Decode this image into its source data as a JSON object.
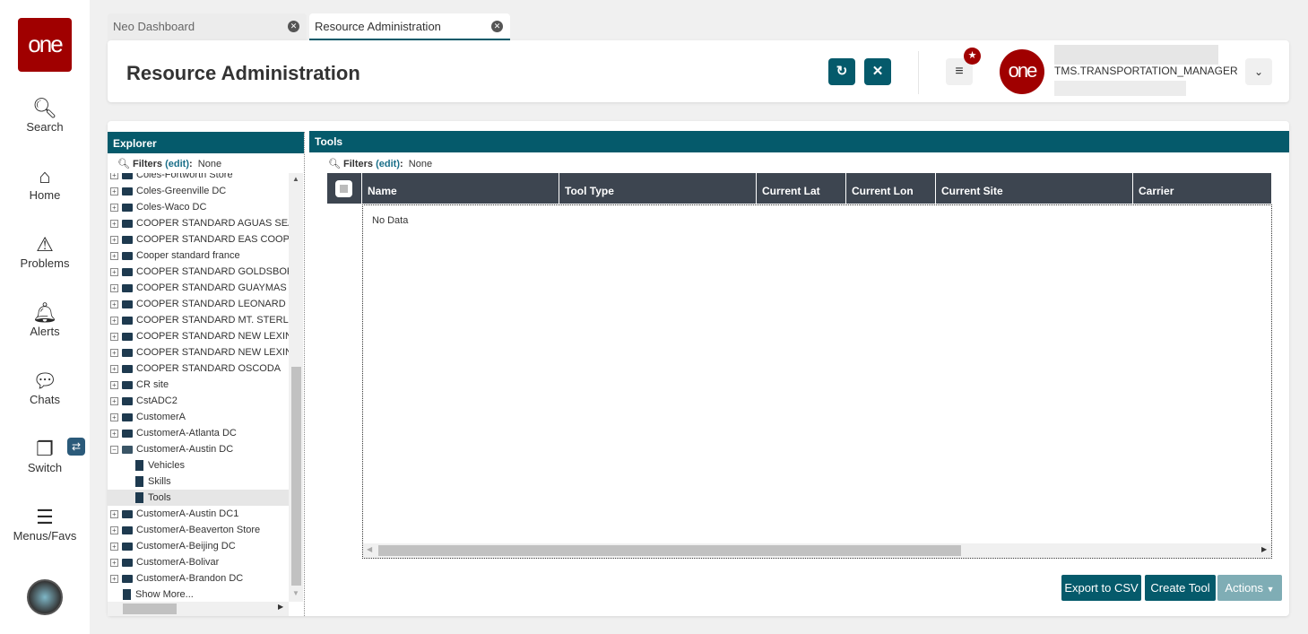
{
  "sidebar": {
    "logo": "one",
    "items": [
      {
        "label": "Search"
      },
      {
        "label": "Home"
      },
      {
        "label": "Problems"
      },
      {
        "label": "Alerts"
      },
      {
        "label": "Chats"
      },
      {
        "label": "Switch"
      },
      {
        "label": "Menus/Favs"
      }
    ]
  },
  "tabs": [
    {
      "label": "Neo Dashboard"
    },
    {
      "label": "Resource Administration"
    }
  ],
  "header": {
    "title": "Resource Administration",
    "user_role": "TMS.TRANSPORTATION_MANAGER",
    "avatar_text": "one"
  },
  "explorer": {
    "title": "Explorer",
    "filters_label": "Filters",
    "edit": "(edit)",
    "filters_value": "None",
    "items": [
      {
        "label": "Coles-Fortworth Store",
        "type": "folder"
      },
      {
        "label": "Coles-Greenville DC",
        "type": "folder"
      },
      {
        "label": "Coles-Waco DC",
        "type": "folder"
      },
      {
        "label": "COOPER STANDARD AGUAS SEAL",
        "type": "folder"
      },
      {
        "label": "COOPER STANDARD EAS COOPER",
        "type": "folder"
      },
      {
        "label": "Cooper standard france",
        "type": "folder"
      },
      {
        "label": "COOPER STANDARD GOLDSBORO",
        "type": "folder"
      },
      {
        "label": "COOPER STANDARD GUAYMAS FI",
        "type": "folder"
      },
      {
        "label": "COOPER STANDARD LEONARD",
        "type": "folder"
      },
      {
        "label": "COOPER STANDARD MT. STERLIN",
        "type": "folder"
      },
      {
        "label": "COOPER STANDARD NEW LEXING",
        "type": "folder"
      },
      {
        "label": "COOPER STANDARD NEW LEXING",
        "type": "folder"
      },
      {
        "label": "COOPER STANDARD OSCODA",
        "type": "folder"
      },
      {
        "label": "CR site",
        "type": "folder"
      },
      {
        "label": "CstADC2",
        "type": "folder"
      },
      {
        "label": "CustomerA",
        "type": "folder"
      },
      {
        "label": "CustomerA-Atlanta DC",
        "type": "folder"
      },
      {
        "label": "CustomerA-Austin DC",
        "type": "open"
      },
      {
        "label": "Vehicles",
        "type": "child"
      },
      {
        "label": "Skills",
        "type": "child"
      },
      {
        "label": "Tools",
        "type": "child",
        "selected": true
      },
      {
        "label": "CustomerA-Austin DC1",
        "type": "folder"
      },
      {
        "label": "CustomerA-Beaverton Store",
        "type": "folder"
      },
      {
        "label": "CustomerA-Beijing DC",
        "type": "folder"
      },
      {
        "label": "CustomerA-Bolivar",
        "type": "folder"
      },
      {
        "label": "CustomerA-Brandon DC",
        "type": "folder"
      },
      {
        "label": "Show More...",
        "type": "more"
      }
    ]
  },
  "tools": {
    "title": "Tools",
    "filters_label": "Filters",
    "edit": "(edit)",
    "filters_value": "None",
    "columns": [
      "Name",
      "Tool Type",
      "Current Lat",
      "Current Lon",
      "Current Site",
      "Carrier"
    ],
    "empty": "No Data",
    "buttons": {
      "export": "Export to CSV",
      "create": "Create Tool",
      "actions": "Actions"
    }
  }
}
